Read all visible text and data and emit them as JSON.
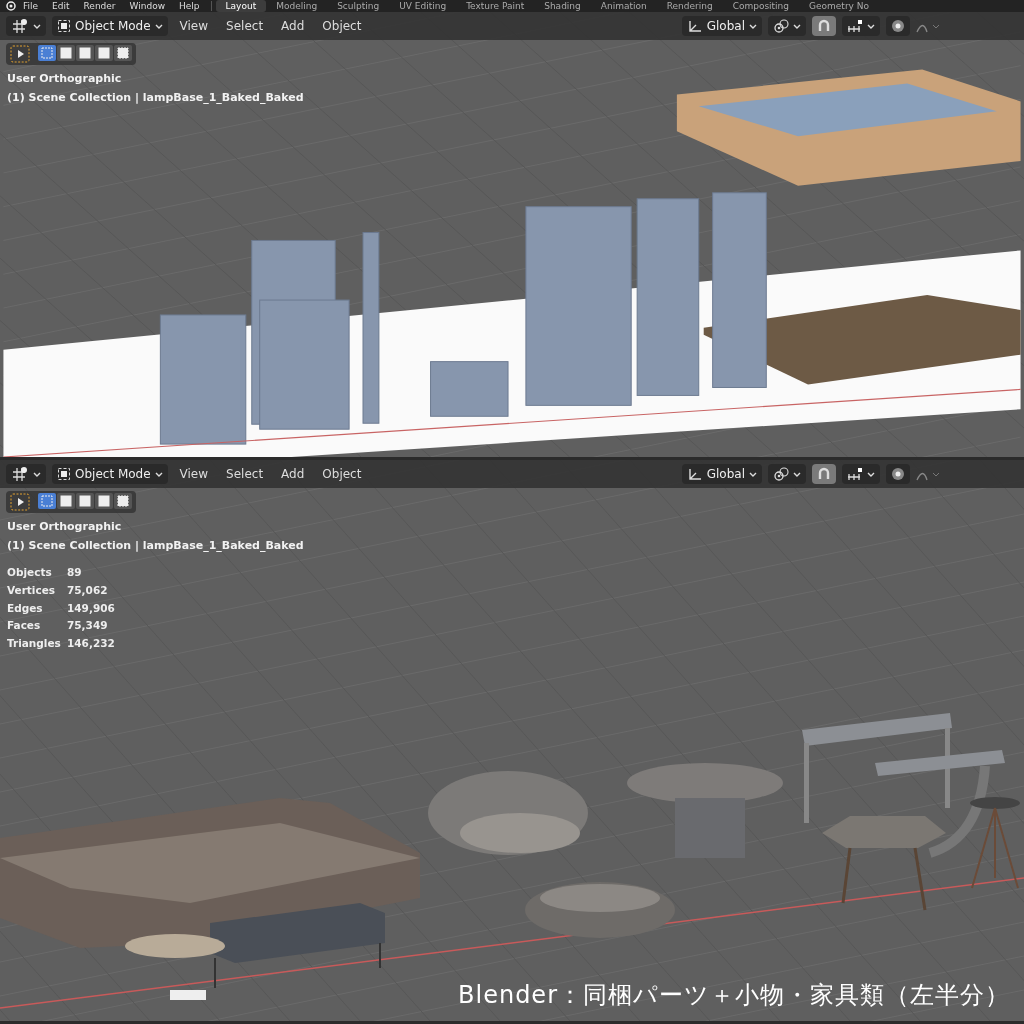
{
  "topbar": {
    "menus": [
      "File",
      "Edit",
      "Render",
      "Window",
      "Help"
    ],
    "workspaces": [
      {
        "label": "Layout",
        "selected": true
      },
      {
        "label": "Modeling",
        "selected": false
      },
      {
        "label": "Sculpting",
        "selected": false
      },
      {
        "label": "UV Editing",
        "selected": false
      },
      {
        "label": "Texture Paint",
        "selected": false
      },
      {
        "label": "Shading",
        "selected": false
      },
      {
        "label": "Animation",
        "selected": false
      },
      {
        "label": "Rendering",
        "selected": false
      },
      {
        "label": "Compositing",
        "selected": false
      },
      {
        "label": "Geometry No",
        "selected": false
      }
    ]
  },
  "viewports": [
    {
      "mode": "Object Mode",
      "menus": [
        "View",
        "Select",
        "Add",
        "Object"
      ],
      "orientation": "Global",
      "snap_on": true,
      "select_modes": [
        {
          "selected": true
        },
        {
          "selected": false
        },
        {
          "selected": false
        },
        {
          "selected": false
        },
        {
          "selected": false
        }
      ],
      "view": "User Orthographic",
      "collection": "(1) Scene Collection | lampBase_1_Baked_Baked",
      "kind": "walls"
    },
    {
      "mode": "Object Mode",
      "menus": [
        "View",
        "Select",
        "Add",
        "Object"
      ],
      "orientation": "Global",
      "snap_on": true,
      "select_modes": [
        {
          "selected": true
        },
        {
          "selected": false
        },
        {
          "selected": false
        },
        {
          "selected": false
        },
        {
          "selected": false
        }
      ],
      "view": "User Orthographic",
      "collection": "(1) Scene Collection | lampBase_1_Baked_Baked",
      "stats": [
        {
          "label": "Objects",
          "value": "89"
        },
        {
          "label": "Vertices",
          "value": "75,062"
        },
        {
          "label": "Edges",
          "value": "149,906"
        },
        {
          "label": "Faces",
          "value": "75,349"
        },
        {
          "label": "Triangles",
          "value": "146,232"
        }
      ],
      "kind": "furniture"
    }
  ],
  "caption": "Blender：同梱パーツ＋小物・家具類（左半分）"
}
